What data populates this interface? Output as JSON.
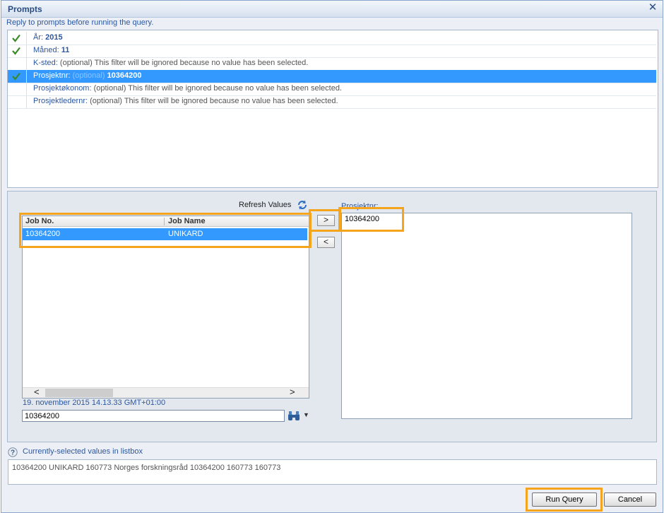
{
  "dialog": {
    "title": "Prompts",
    "instruction": "Reply to prompts before running the query."
  },
  "prompts": [
    {
      "name": "År:",
      "optional": "",
      "value": "2015",
      "checked": true
    },
    {
      "name": "Måned:",
      "optional": "",
      "value": "11",
      "checked": true
    },
    {
      "name": "K-sted:",
      "optional": "(optional) This filter will be ignored because no value has been selected.",
      "value": "",
      "checked": false
    },
    {
      "name": "Prosjektnr:",
      "optional": "(optional)",
      "value": "10364200",
      "checked": true,
      "selected": true
    },
    {
      "name": "Prosjektøkonom:",
      "optional": "(optional) This filter will be ignored because no value has been selected.",
      "value": "",
      "checked": false
    },
    {
      "name": "Prosjektledernr:",
      "optional": "(optional) This filter will be ignored because no value has been selected.",
      "value": "",
      "checked": false
    }
  ],
  "lov": {
    "refresh_label": "Refresh Values",
    "columns": [
      "Job No.",
      "Job Name"
    ],
    "rows": [
      {
        "job_no": "10364200",
        "job_name": "UNIKARD"
      }
    ],
    "timestamp": "19. november 2015 14.13.33 GMT+01:00",
    "search_value": "10364200",
    "add_label": ">",
    "remove_label": "<",
    "scroll_left": "<",
    "scroll_right": ">"
  },
  "selected": {
    "label": "Prosjektnr:",
    "items": [
      "10364200"
    ]
  },
  "help": {
    "text": "Currently-selected values in listbox",
    "values": "10364200 UNIKARD 160773 Norges forskningsråd 10364200 160773 160773"
  },
  "buttons": {
    "run": "Run Query",
    "cancel": "Cancel"
  },
  "colors": {
    "selection": "#3399ff",
    "highlight": "#f4a41d",
    "link_blue": "#2c57a0",
    "check_green": "#3a8a2a"
  }
}
